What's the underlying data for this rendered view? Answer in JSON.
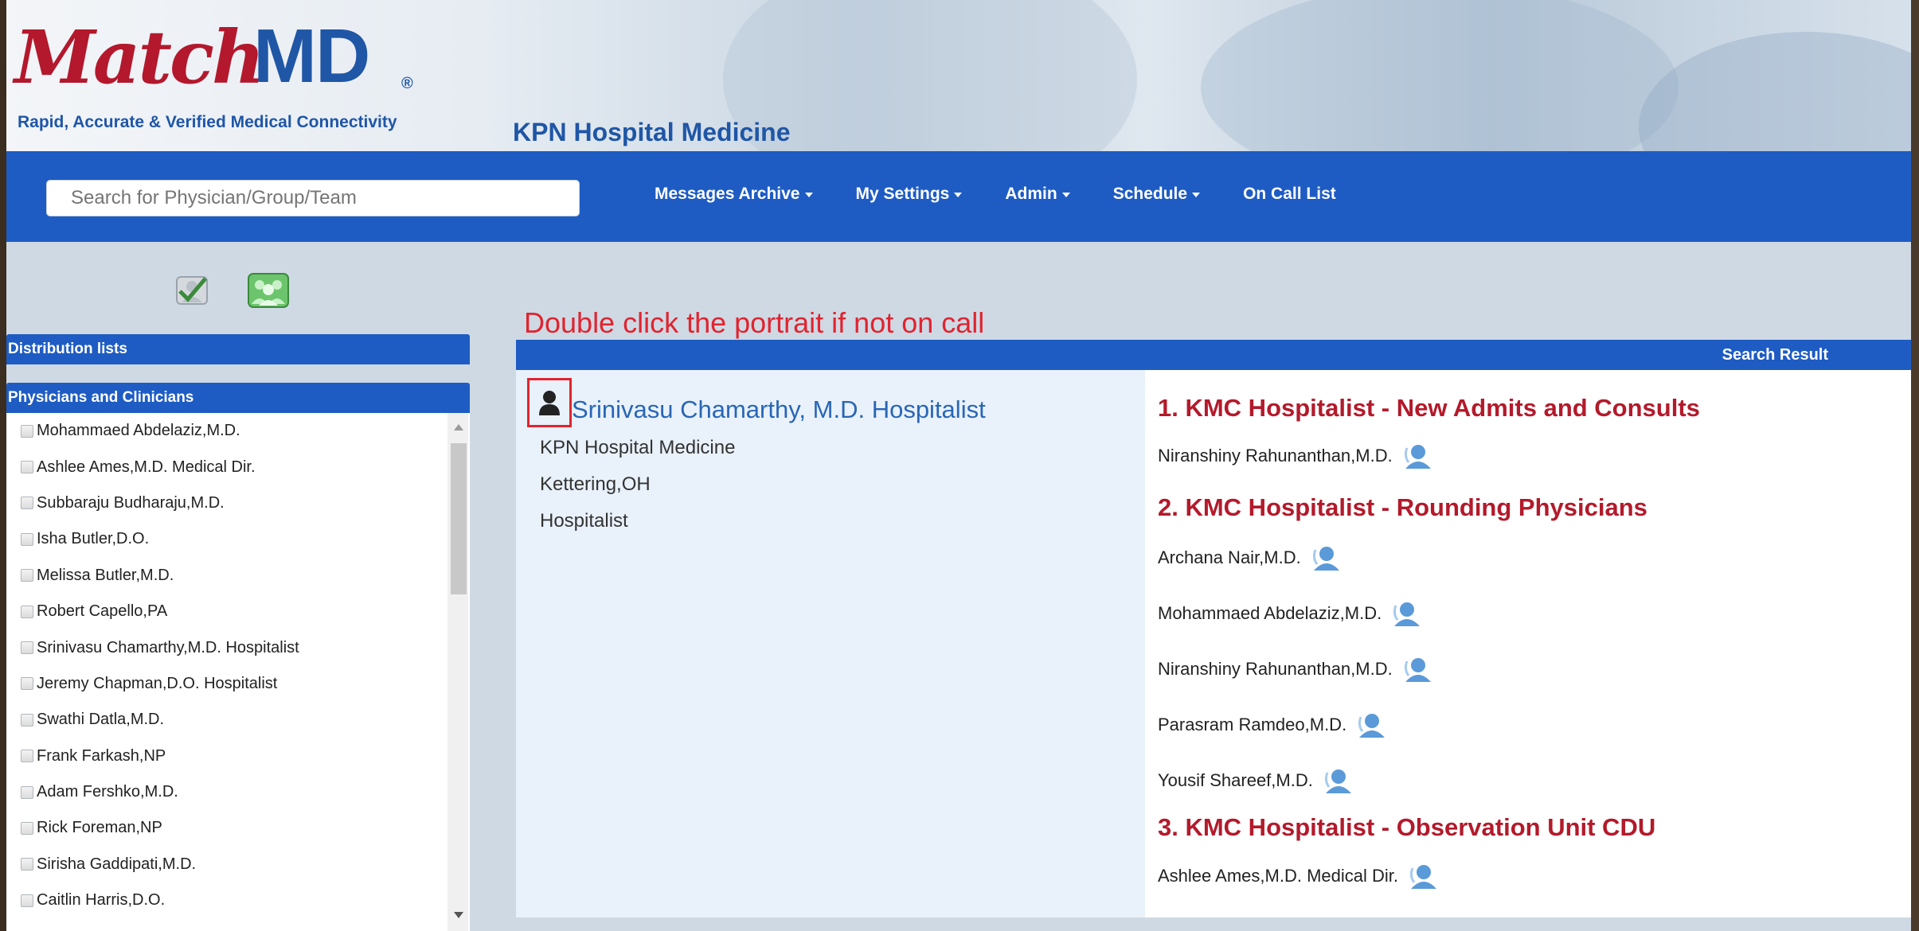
{
  "header": {
    "logo_match": "Match",
    "logo_md": "MD",
    "logo_reg": "®",
    "tagline": "Rapid, Accurate & Verified Medical Connectivity",
    "hospital": "KPN Hospital Medicine"
  },
  "navbar": {
    "search_placeholder": "Search for Physician/Group/Team",
    "items": [
      {
        "label": "Messages Archive",
        "dropdown": true
      },
      {
        "label": "My Settings",
        "dropdown": true
      },
      {
        "label": "Admin",
        "dropdown": true
      },
      {
        "label": "Schedule",
        "dropdown": true
      },
      {
        "label": "On Call List",
        "dropdown": false
      }
    ]
  },
  "annotation": "Double click the portrait if not on call",
  "sidebar": {
    "distribution_lists": "Distribution lists",
    "physicians_header": "Physicians and Clinicians",
    "physicians": [
      "Mohammaed Abdelaziz,M.D.",
      "Ashlee Ames,M.D. Medical Dir.",
      "Subbaraju Budharaju,M.D.",
      "Isha Butler,D.O.",
      "Melissa Butler,M.D.",
      "Robert Capello,PA",
      "Srinivasu Chamarthy,M.D. Hospitalist",
      "Jeremy Chapman,D.O. Hospitalist",
      "Swathi Datla,M.D.",
      "Frank Farkash,NP",
      "Adam Fershko,M.D.",
      "Rick Foreman,NP",
      "Sirisha Gaddipati,M.D.",
      "Caitlin Harris,D.O."
    ]
  },
  "result": {
    "header": "Search Result",
    "profile": {
      "name": "Srinivasu Chamarthy, M.D. Hospitalist",
      "department": "KPN Hospital Medicine",
      "location": "Kettering,OH",
      "role": "Hospitalist"
    },
    "groups": [
      {
        "title": "1. KMC Hospitalist - New Admits and Consults",
        "members": [
          "Niranshiny Rahunanthan,M.D."
        ]
      },
      {
        "title": "2. KMC Hospitalist - Rounding Physicians",
        "members": [
          "Archana Nair,M.D.",
          "Mohammaed Abdelaziz,M.D.",
          "Niranshiny Rahunanthan,M.D.",
          "Parasram Ramdeo,M.D.",
          "Yousif Shareef,M.D."
        ]
      },
      {
        "title": "3. KMC Hospitalist - Observation Unit CDU",
        "members": [
          "Ashlee Ames,M.D. Medical Dir."
        ]
      }
    ]
  },
  "colors": {
    "brand_blue": "#1e5cc3",
    "brand_red": "#b3182d",
    "annotation_red": "#e0242f",
    "group_title": "#b31a2b"
  }
}
